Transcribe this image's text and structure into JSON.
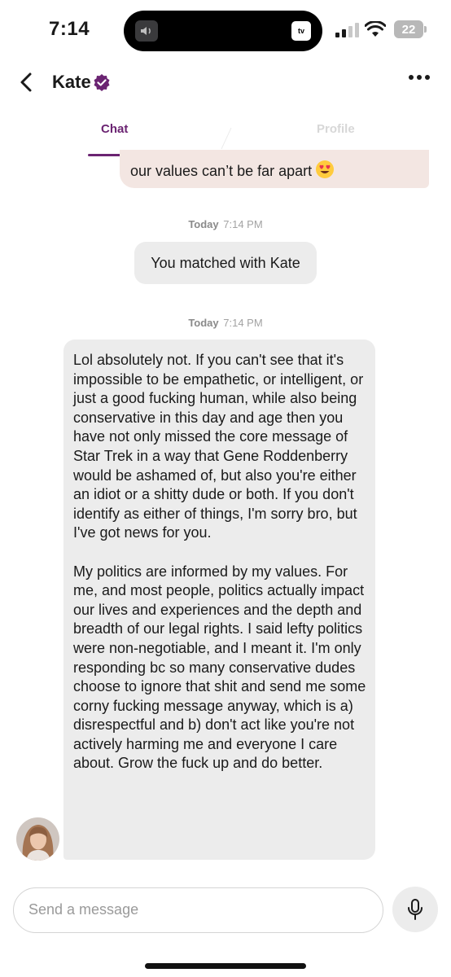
{
  "status_bar": {
    "time": "7:14",
    "island_app": "tv",
    "battery": "22",
    "icons": [
      "speaker-icon",
      "apple-tv-icon",
      "signal-icon",
      "wifi-icon",
      "battery-icon"
    ]
  },
  "header": {
    "name": "Kate",
    "icons": [
      "back-chevron-icon",
      "verified-badge-icon",
      "more-options-icon"
    ]
  },
  "tabs": [
    {
      "label": "Chat",
      "active": true
    },
    {
      "label": "Profile",
      "active": false
    }
  ],
  "colors": {
    "accent": "#6b2472",
    "sent_bubble": "#f3e6e2",
    "received_bubble": "#ececec"
  },
  "messages": {
    "sent_partial": {
      "visible_line": "our values can’t be far apart",
      "emoji": "heart-eyes-emoji"
    },
    "timestamp_1": {
      "day": "Today",
      "time": "7:14 PM"
    },
    "system": "You matched with Kate",
    "timestamp_2": {
      "day": "Today",
      "time": "7:14 PM"
    },
    "received": {
      "paragraphs": [
        "Lol absolutely not. If you can't see that it's impossible to be empathetic, or intelligent, or just a good fucking human, while also being conservative in this day and age then you have not only missed the core message of Star Trek in a way that Gene Roddenberry would be ashamed of, but also you're either an idiot or a shitty dude or both. If you don't identify as either of things, I'm sorry bro, but I've got news for you.",
        "My politics are informed by my values. For me, and most people, politics actually impact our lives and experiences and the depth and breadth of our legal rights. I said lefty politics were non-negotiable, and I meant it. I'm only responding bc so many conservative dudes choose to ignore that shit and send me some corny fucking message anyway, which is a) disrespectful and b) don't act like you're not actively harming me and everyone I care about. Grow the fuck up and do better."
      ]
    }
  },
  "composer": {
    "placeholder": "Send a message",
    "value": "",
    "icons": [
      "microphone-icon"
    ]
  }
}
